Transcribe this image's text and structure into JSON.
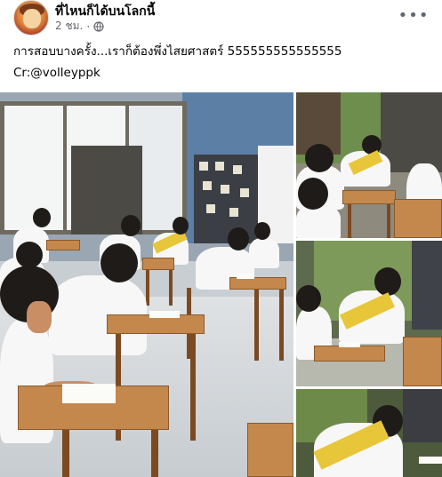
{
  "post": {
    "page_name": "ที่ไหนก็ได้บนโลกนี้",
    "time": "2 ชม.",
    "time_separator": "·",
    "caption": "การสอบบางครั้ง...เราก็ต้องพึ่งไสยศาสตร์ 555555555555555",
    "credit": "Cr:@volleyppk"
  },
  "icons": {
    "globe": "globe-icon",
    "more": "more-options-icon"
  },
  "more_glyph": "•••",
  "colors": {
    "text_primary": "#050505",
    "text_secondary": "#65676b",
    "sash_yellow": "#e8c63a"
  }
}
